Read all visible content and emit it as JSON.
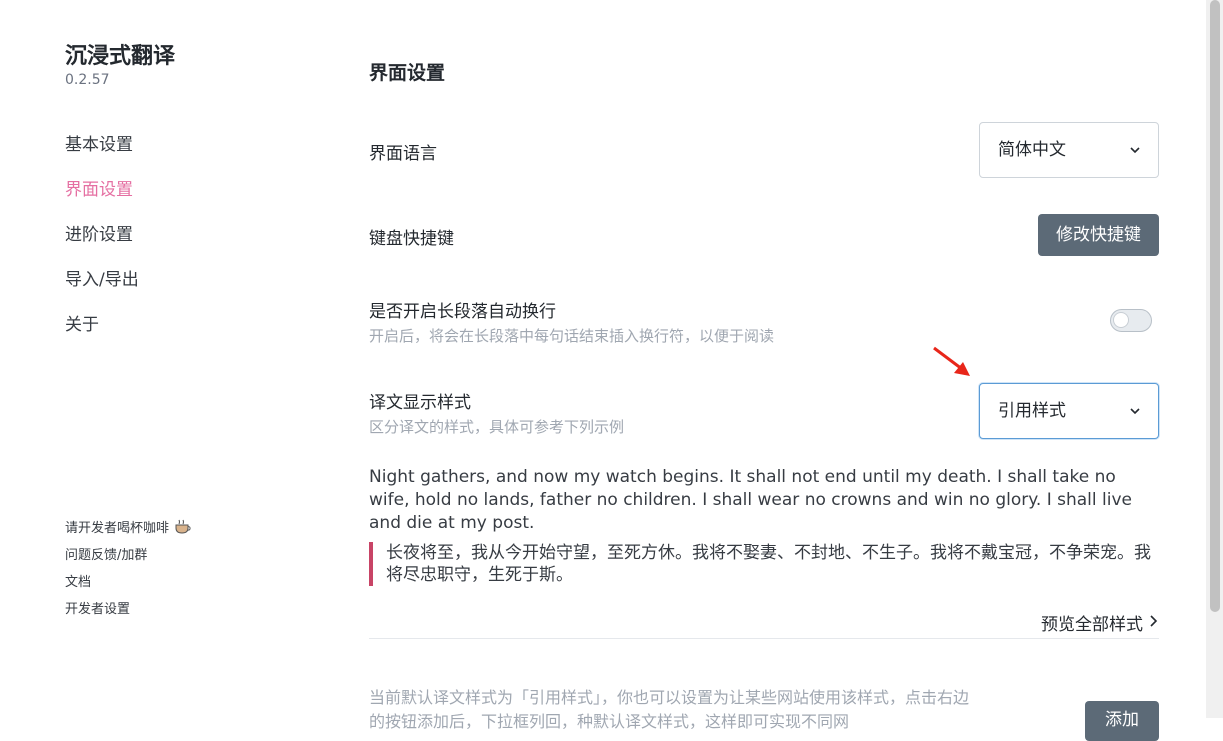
{
  "app": {
    "title": "沉浸式翻译",
    "version": "0.2.57"
  },
  "sidebar": {
    "items": [
      {
        "label": "基本设置",
        "active": false
      },
      {
        "label": "界面设置",
        "active": true
      },
      {
        "label": "进阶设置",
        "active": false
      },
      {
        "label": "导入/导出",
        "active": false
      },
      {
        "label": "关于",
        "active": false
      }
    ],
    "footer": [
      {
        "label": "请开发者喝杯咖啡",
        "icon": "coffee-cup-icon"
      },
      {
        "label": "问题反馈/加群"
      },
      {
        "label": "文档"
      },
      {
        "label": "开发者设置"
      }
    ],
    "active_color": "#e56fa2"
  },
  "main": {
    "section_title": "界面设置",
    "language": {
      "label": "界面语言",
      "value": "简体中文"
    },
    "shortcut": {
      "label": "键盘快捷键",
      "button": "修改快捷键"
    },
    "auto_wrap": {
      "label": "是否开启长段落自动换行",
      "desc": "开启后，将会在长段落中每句话结束插入换行符，以便于阅读",
      "enabled": false
    },
    "style": {
      "label": "译文显示样式",
      "desc": "区分译文的样式，具体可参考下列示例",
      "value": "引用样式"
    },
    "sample_original": "Night gathers, and now my watch begins. It shall not end until my death. I shall take no wife, hold no lands, father no children. I shall wear no crowns and win no glory. I shall live and die at my post.",
    "sample_translation": "长夜将至，我从今开始守望，至死方休。我将不娶妻、不封地、不生子。我将不戴宝冠，不争荣宠。我将尽忠职守，生死于斯。",
    "preview_link": "预览全部样式",
    "bottom_desc": "当前默认译文样式为「引用样式」，你也可以设置为让某些网站使用该样式，点击右边的按钮添加后，下拉框列回，种默认译文样式，这样即可实现不同网",
    "add_button": "添加"
  },
  "colors": {
    "button": "#5c6a77",
    "quote_border": "#c84466",
    "arrow": "#e8261a"
  }
}
